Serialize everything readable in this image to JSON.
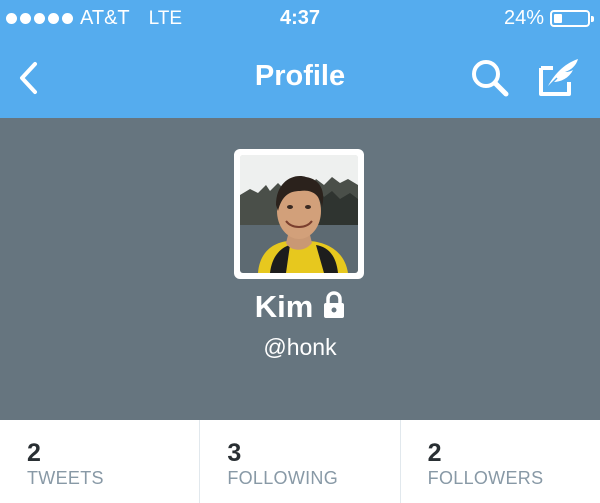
{
  "status_bar": {
    "carrier": "AT&T",
    "network": "LTE",
    "time": "4:37",
    "battery_percent": "24%",
    "battery_level": 0.24,
    "signal_dots": 5
  },
  "nav": {
    "title": "Profile",
    "back_icon": "chevron-left-icon",
    "search_icon": "search-icon",
    "compose_icon": "compose-tweet-icon"
  },
  "profile": {
    "name": "Kim",
    "handle": "@honk",
    "protected": true,
    "lock_icon": "lock-icon"
  },
  "stats": [
    {
      "count": "2",
      "label": "TWEETS"
    },
    {
      "count": "3",
      "label": "FOLLOWING"
    },
    {
      "count": "2",
      "label": "FOLLOWERS"
    }
  ],
  "colors": {
    "nav_blue": "#55acee",
    "header_gray": "#66757f",
    "stat_label": "#8899a6",
    "stat_count": "#292f33"
  }
}
